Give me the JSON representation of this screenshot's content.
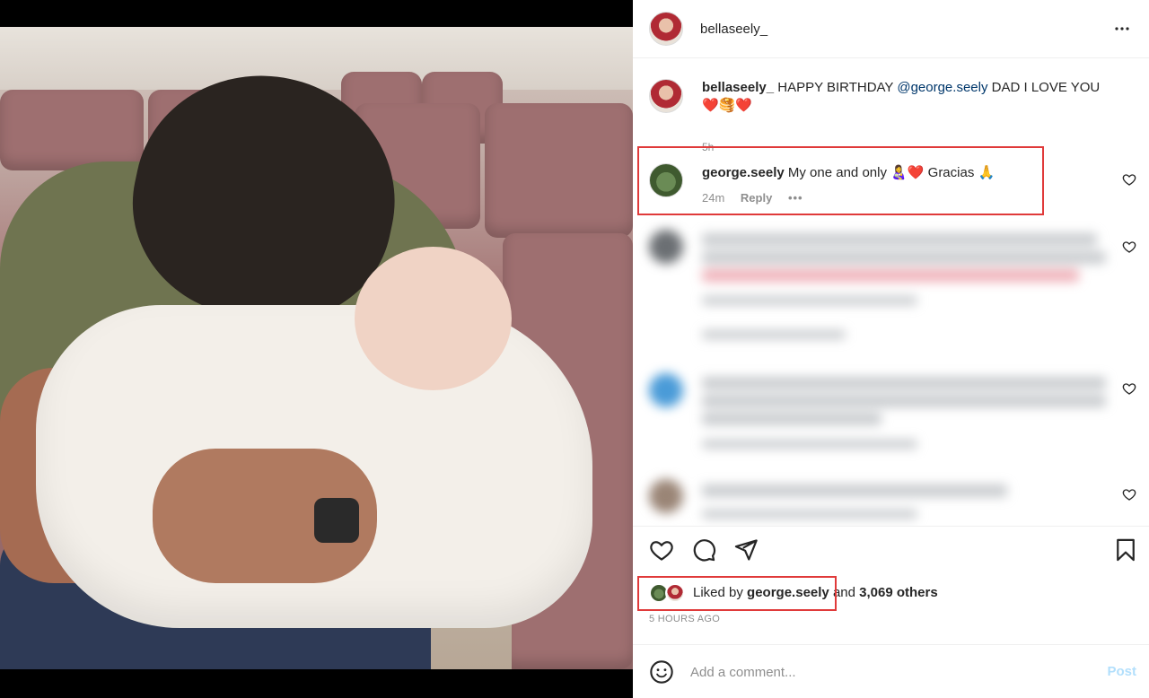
{
  "header": {
    "username": "bellaseely_",
    "more_icon": "more-horizontal-icon"
  },
  "caption": {
    "username": "bellaseely_",
    "text_before": "HAPPY BIRTHDAY",
    "mention": "@george.seely",
    "text_after": "DAD I LOVE YOU",
    "emojis": "❤️🥞❤️",
    "time": "5h"
  },
  "comment": {
    "username": "george.seely",
    "text": "My one and only 👩‍🍼❤️ Gracias 🙏",
    "time": "24m",
    "reply_label": "Reply",
    "more": "•••"
  },
  "likes": {
    "prefix": "Liked by",
    "user": "george.seely",
    "suffix": "and",
    "count": "3,069 others"
  },
  "timestamp": "5 HOURS AGO",
  "add_comment": {
    "placeholder": "Add a comment...",
    "post_label": "Post"
  },
  "colors": {
    "highlight": "#e03a3a",
    "mention": "#00376b",
    "post_disabled": "#b2dffc"
  }
}
